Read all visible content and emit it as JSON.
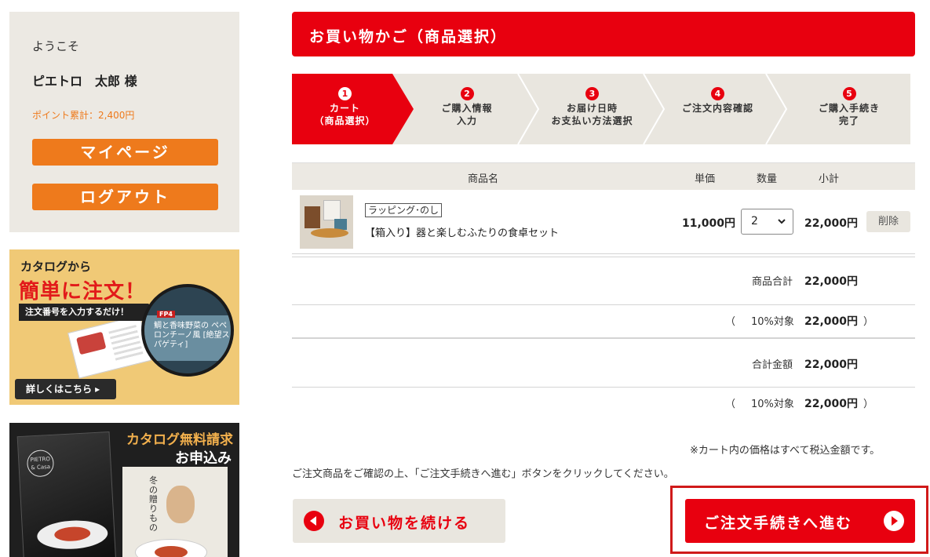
{
  "sidebar": {
    "welcome": "ようこそ",
    "user_name": "ピエトロ　太郎 様",
    "points": "ポイント累計：2,400円",
    "mypage_label": "マイページ",
    "logout_label": "ログアウト",
    "catalog_banner": {
      "line1": "カタログから",
      "line2": "簡単に注文！",
      "ribbon": "注文番号を入力するだけ！",
      "code": "FP4",
      "product": "鯛と香味野菜の ペペロンチーノ風 [絶望スパゲティ]",
      "detail_label": "詳しくはこちら ▸"
    },
    "request_banner": {
      "title": "カタログ無料請求",
      "subtitle": "お申込み",
      "logo": "PIETRO & Casa",
      "book_text": "冬の贈りもの"
    }
  },
  "header": {
    "title": "お買い物かご（商品選択）"
  },
  "steps": [
    {
      "num": "1",
      "label": "カート\n（商品選択）",
      "active": true
    },
    {
      "num": "2",
      "label": "ご購入情報\n入力",
      "active": false
    },
    {
      "num": "3",
      "label": "お届け日時\nお支払い方法選択",
      "active": false
    },
    {
      "num": "4",
      "label": "ご注文内容確認",
      "active": false
    },
    {
      "num": "5",
      "label": "ご購入手続き\n完了",
      "active": false
    }
  ],
  "table": {
    "headers": {
      "name": "商品名",
      "unit_price": "単価",
      "quantity": "数量",
      "subtotal": "小計"
    },
    "items": [
      {
        "tag": "ラッピング･のし",
        "name": "【箱入り】器と楽しむふたりの食卓セット",
        "unit_price": "11,000円",
        "quantity": "2",
        "subtotal": "22,000円",
        "delete_label": "削除"
      }
    ]
  },
  "summary": {
    "product_total_label": "商品合計",
    "product_total_value": "22,000円",
    "tax1_open": "（",
    "tax1_label": "10%対象",
    "tax1_value": "22,000円",
    "tax1_close": "）",
    "grand_total_label": "合計金額",
    "grand_total_value": "22,000円",
    "tax2_open": "（",
    "tax2_label": "10%対象",
    "tax2_value": "22,000円",
    "tax2_close": "）"
  },
  "notes": {
    "tax_note": "※カート内の価格はすべて税込金額です。",
    "instruction": "ご注文商品をご確認の上、「ご注文手続きへ進む」ボタンをクリックしてください。"
  },
  "actions": {
    "continue_label": "お買い物を続ける",
    "proceed_label": "ご注文手続きへ進む"
  },
  "colors": {
    "brand_red": "#e8000f",
    "accent_orange": "#ee7a1c",
    "panel_beige": "#ece9e3"
  }
}
